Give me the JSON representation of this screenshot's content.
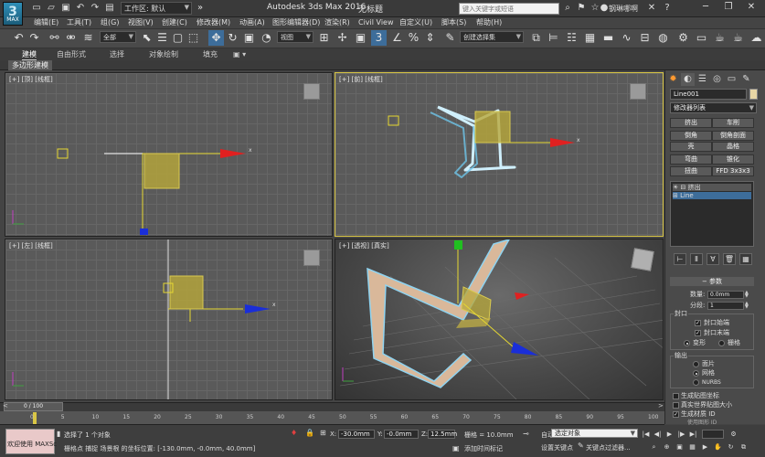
{
  "titlebar": {
    "app_logo_label": "MAX",
    "workspace": "工作区: 默认",
    "app_title": "Autodesk 3ds Max 2016",
    "doc_title": "无标题",
    "search_placeholder": "键入关键字或短语",
    "user_name": "钢琳哪啊"
  },
  "menu": [
    "编辑(E)",
    "工具(T)",
    "组(G)",
    "视图(V)",
    "创建(C)",
    "修改器(M)",
    "动画(A)",
    "图形编辑器(D)",
    "渲染(R)",
    "Civil View",
    "自定义(U)",
    "脚本(S)",
    "帮助(H)"
  ],
  "toolbar": {
    "selection_filter": "全部",
    "ref_coord": "视图",
    "named_selection": "创建选择集"
  },
  "ribbon": {
    "tabs": [
      "建模",
      "自由形式",
      "选择",
      "对象绘制",
      "填充"
    ],
    "active_tab": "建模",
    "sub_label": "多边形建模"
  },
  "viewports": {
    "top_label": "[+] [顶] [线框]",
    "front_label": "[+] [前] [线框]",
    "left_label": "[+] [左] [线框]",
    "persp_label": "[+] [透视] [真实]",
    "axis_x": "x",
    "colors": {
      "grid": "#5a5a5a",
      "shape_line": "#cfeffc",
      "box_fill": "#b8a83a",
      "axis_red": "#e02020",
      "axis_blue": "#1a2ed8",
      "axis_green": "#20c020",
      "extrude_face": "#d9b89a"
    }
  },
  "command_panel": {
    "object_name": "Line001",
    "object_color": "#e8d6a5",
    "modifier_list": "修改器列表",
    "mod_buttons": [
      [
        "挤出",
        "车削"
      ],
      [
        "倒角",
        "倒角剖面"
      ],
      [
        "壳",
        "晶格"
      ],
      [
        "弯曲",
        "锥化"
      ],
      [
        "扭曲",
        "FFD 3x3x3"
      ]
    ],
    "stack": [
      "挤出",
      "Line"
    ],
    "params_title": "参数",
    "amount_label": "数量:",
    "amount_value": "0.0mm",
    "segments_label": "分段:",
    "segments_value": "1",
    "cap_group": "封口",
    "cap_start": "封口始端",
    "cap_end": "封口末端",
    "morph": "变形",
    "grid": "栅格",
    "output_group": "输出",
    "out_patch": "面片",
    "out_mesh": "网格",
    "out_nurbs": "NURBS",
    "gen_map": "生成贴图坐标",
    "real_world": "真实世界贴图大小",
    "gen_mat": "生成材质 ID",
    "gen_mat_more": "使用图形 ID"
  },
  "timeline": {
    "frame": "0 / 100",
    "ticks": [
      "0",
      "5",
      "10",
      "15",
      "20",
      "25",
      "30",
      "35",
      "40",
      "45",
      "50",
      "55",
      "60",
      "65",
      "70",
      "75",
      "80",
      "85",
      "90",
      "95",
      "100"
    ]
  },
  "status": {
    "welcome": "欢迎使用 MAXSc",
    "selected": "选择了 1 个对象",
    "prompt": "栅格点 捕捉 场景根 的坐标位置: [-130.0mm, -0.0mm, 40.0mm]",
    "x_label": "X:",
    "x_value": "-30.0mm",
    "y_label": "Y:",
    "y_value": "-0.0mm",
    "z_label": "Z:",
    "z_value": "12.5mm",
    "grid": "栅格 = 10.0mm",
    "auto_key": "自动关键点",
    "sel_filter": "选定对象",
    "set_key": "设置关键点",
    "key_filters": "关键点过滤器...",
    "add_time_tag": "添加时间标记"
  }
}
